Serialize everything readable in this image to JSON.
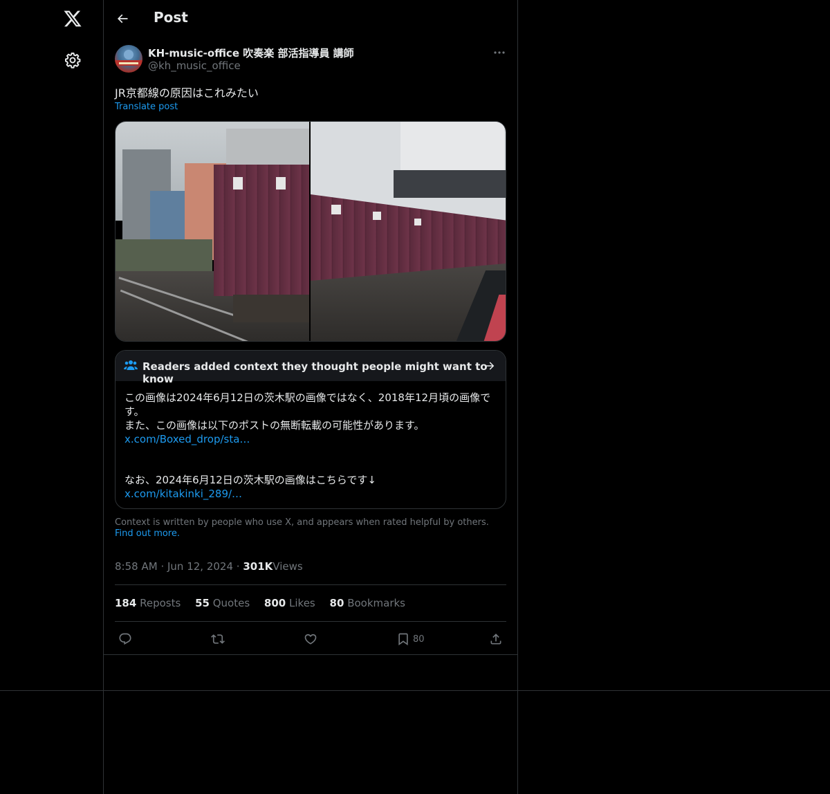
{
  "header": {
    "title": "Post"
  },
  "author": {
    "name": "KH-music-office 吹奏楽 部活指導員 講師",
    "handle": "@kh_music_office"
  },
  "post": {
    "text": "JR京都線の原因はこれみたい",
    "translate": "Translate post"
  },
  "note": {
    "title": "Readers added context they thought people might want to know",
    "line1": "この画像は2024年6月12日の茨木駅の画像ではなく、2018年12月頃の画像で",
    "line2": "す。",
    "line3": "また、この画像は以下のポストの無断転載の可能性があります。",
    "link1": "x.com/Boxed_drop/sta…",
    "line4": "なお、2024年6月12日の茨木駅の画像はこちらです↓",
    "link2": "x.com/kitakinki_289/…"
  },
  "context": {
    "text": "Context is written by people who use X, and appears when rated helpful by others.",
    "link": "Find out more."
  },
  "meta": {
    "time": "8:58 AM",
    "sep": "·",
    "date": "Jun 12, 2024",
    "views_count": "301K",
    "views_label": "Views"
  },
  "stats": [
    {
      "count": "184",
      "label": "Reposts"
    },
    {
      "count": "55",
      "label": "Quotes"
    },
    {
      "count": "800",
      "label": "Likes"
    },
    {
      "count": "80",
      "label": "Bookmarks"
    }
  ],
  "actions": {
    "bookmark_count": "80"
  },
  "icons": [
    "x-logo-icon",
    "gear-icon",
    "back-arrow-icon",
    "more-icon",
    "community-notes-icon",
    "arrow-right-icon",
    "reply-icon",
    "repost-icon",
    "like-icon",
    "bookmark-icon",
    "share-icon"
  ],
  "colors": {
    "accent": "#1d9bf0",
    "text": "#e7e9ea",
    "muted": "#71767b",
    "border": "#2f3336",
    "background": "#000000"
  }
}
